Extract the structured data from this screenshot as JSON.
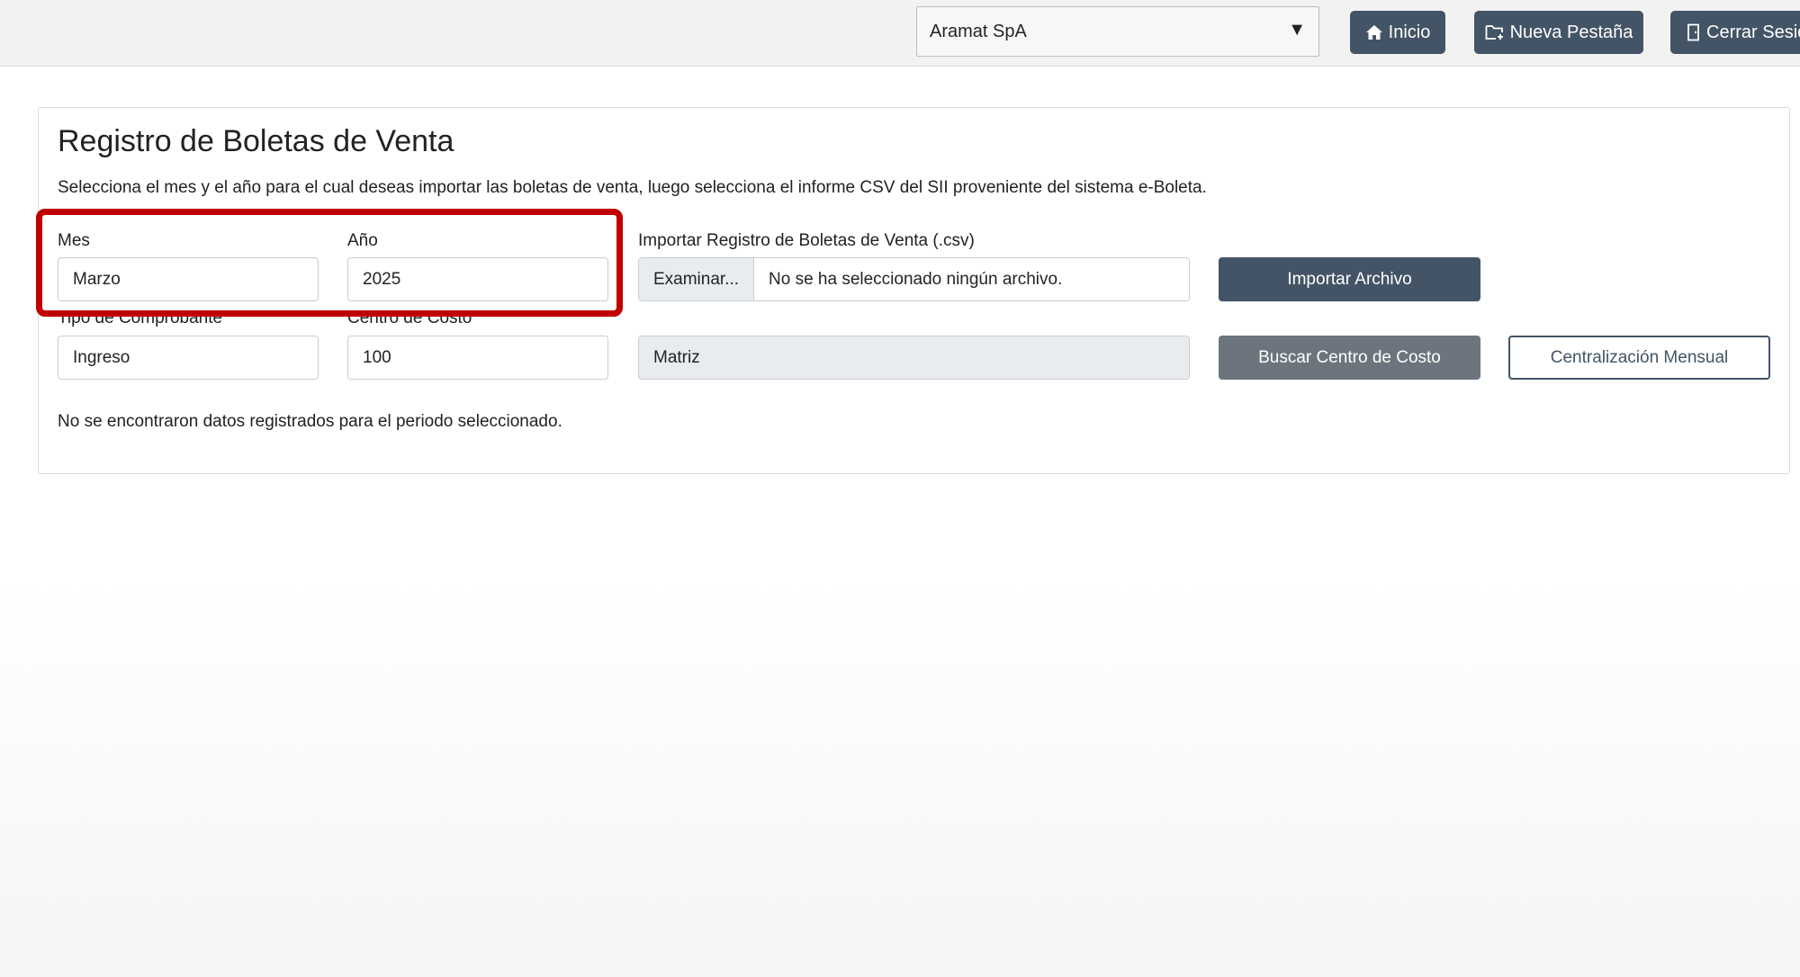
{
  "header": {
    "company": "Aramat SpA",
    "buttons": {
      "inicio": "Inicio",
      "nueva_pestana": "Nueva Pestaña",
      "cerrar_sesion": "Cerrar Sesió"
    }
  },
  "page": {
    "title": "Registro de Boletas de Venta",
    "description": "Selecciona el mes y el año para el cual deseas importar las boletas de venta, luego selecciona el informe CSV del SII proveniente del sistema e-Boleta."
  },
  "form": {
    "mes": {
      "label": "Mes",
      "value": "Marzo"
    },
    "anio": {
      "label": "Año",
      "value": "2025"
    },
    "tipo_comprobante": {
      "label": "Tipo de Comprobante",
      "value": "Ingreso"
    },
    "centro_costo": {
      "label": "Centro de Costo",
      "value": "100"
    },
    "centro_costo_nombre": {
      "value": "Matriz"
    },
    "importar": {
      "label": "Importar Registro de Boletas de Venta (.csv)",
      "browse": "Examinar...",
      "filename": "No se ha seleccionado ningún archivo."
    }
  },
  "buttons": {
    "importar_archivo": "Importar Archivo",
    "buscar_centro_costo": "Buscar Centro de Costo",
    "centralizacion_mensual": "Centralización Mensual"
  },
  "messages": {
    "empty": "No se encontraron datos registrados para el periodo seleccionado."
  },
  "colors": {
    "primary": "#435466",
    "secondary": "#6c757d",
    "highlight": "#c00000"
  }
}
